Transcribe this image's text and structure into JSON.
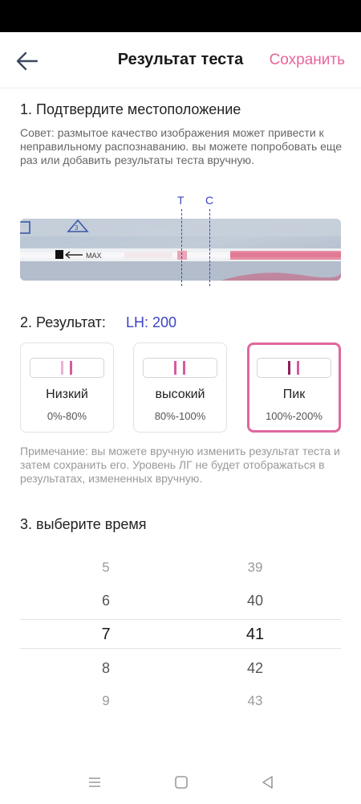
{
  "header": {
    "title": "Результат теста",
    "save_label": "Сохранить"
  },
  "section1": {
    "title": "1. Подтвердите местоположение",
    "tip": "Совет: размытое качество изображения может привести к неправильному распознаванию. вы можете попробовать еще раз или добавить результаты теста вручную.",
    "t_label": "T",
    "c_label": "C",
    "photo_text": "MAX"
  },
  "section2": {
    "title": "2. Результат:",
    "lh_value": "LH: 200",
    "cards": [
      {
        "name": "Низкий",
        "range": "0%-80%",
        "selected": false,
        "t_color": "#eab0d3",
        "c_color": "#d65aa0"
      },
      {
        "name": "высокий",
        "range": "80%-100%",
        "selected": false,
        "t_color": "#d65aa0",
        "c_color": "#d65aa0"
      },
      {
        "name": "Пик",
        "range": "100%-200%",
        "selected": true,
        "t_color": "#8e1f5b",
        "c_color": "#d65aa0"
      }
    ],
    "note": "Примечание: вы можете вручную изменить результат теста и затем сохранить его. Уровень ЛГ не будет отображаться в результатах, измененных вручную."
  },
  "section3": {
    "title": "3. выберите время",
    "hours": [
      "5",
      "6",
      "7",
      "8",
      "9"
    ],
    "minutes": [
      "39",
      "40",
      "41",
      "42",
      "43"
    ],
    "selected_hour": "7",
    "selected_minute": "41"
  },
  "colors": {
    "accent": "#e8659c",
    "blue": "#3a45c0",
    "selected_border": "#e0679f"
  },
  "icons": {
    "back": "back-arrow-icon",
    "nav_menu": "menu-icon",
    "nav_home": "home-icon",
    "nav_back": "back-triangle-icon"
  }
}
